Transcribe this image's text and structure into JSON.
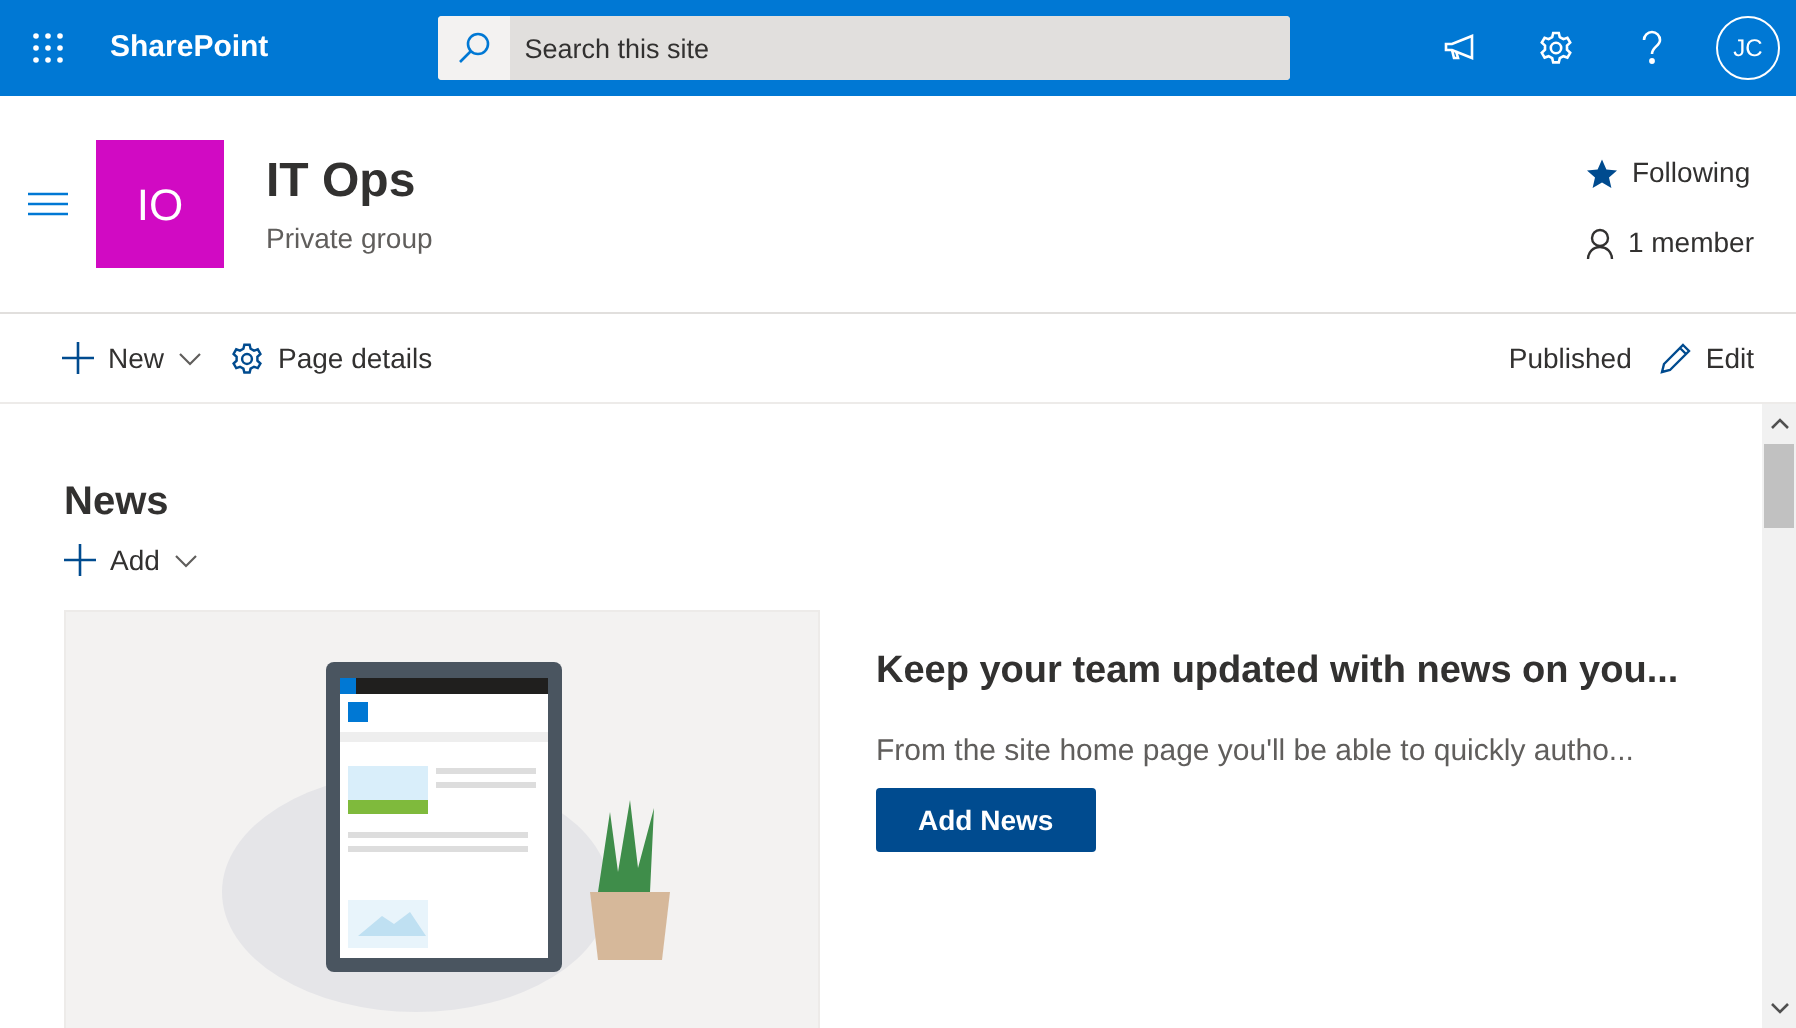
{
  "app_bar": {
    "app_name": "SharePoint",
    "search": {
      "placeholder": "Search this site"
    },
    "avatar_initials": "JC"
  },
  "site_header": {
    "logo_initials": "IO",
    "title": "IT Ops",
    "subtitle": "Private group",
    "following": true,
    "follow_label": "Following",
    "members_label": "1 member"
  },
  "command_bar": {
    "new_label": "New",
    "page_details_label": "Page details",
    "status": "Published",
    "edit_label": "Edit"
  },
  "news": {
    "title": "News",
    "add_label": "Add",
    "headline": "Keep your team updated with news on you...",
    "description": "From the site home page you'll be able to quickly autho...",
    "button": "Add News"
  }
}
